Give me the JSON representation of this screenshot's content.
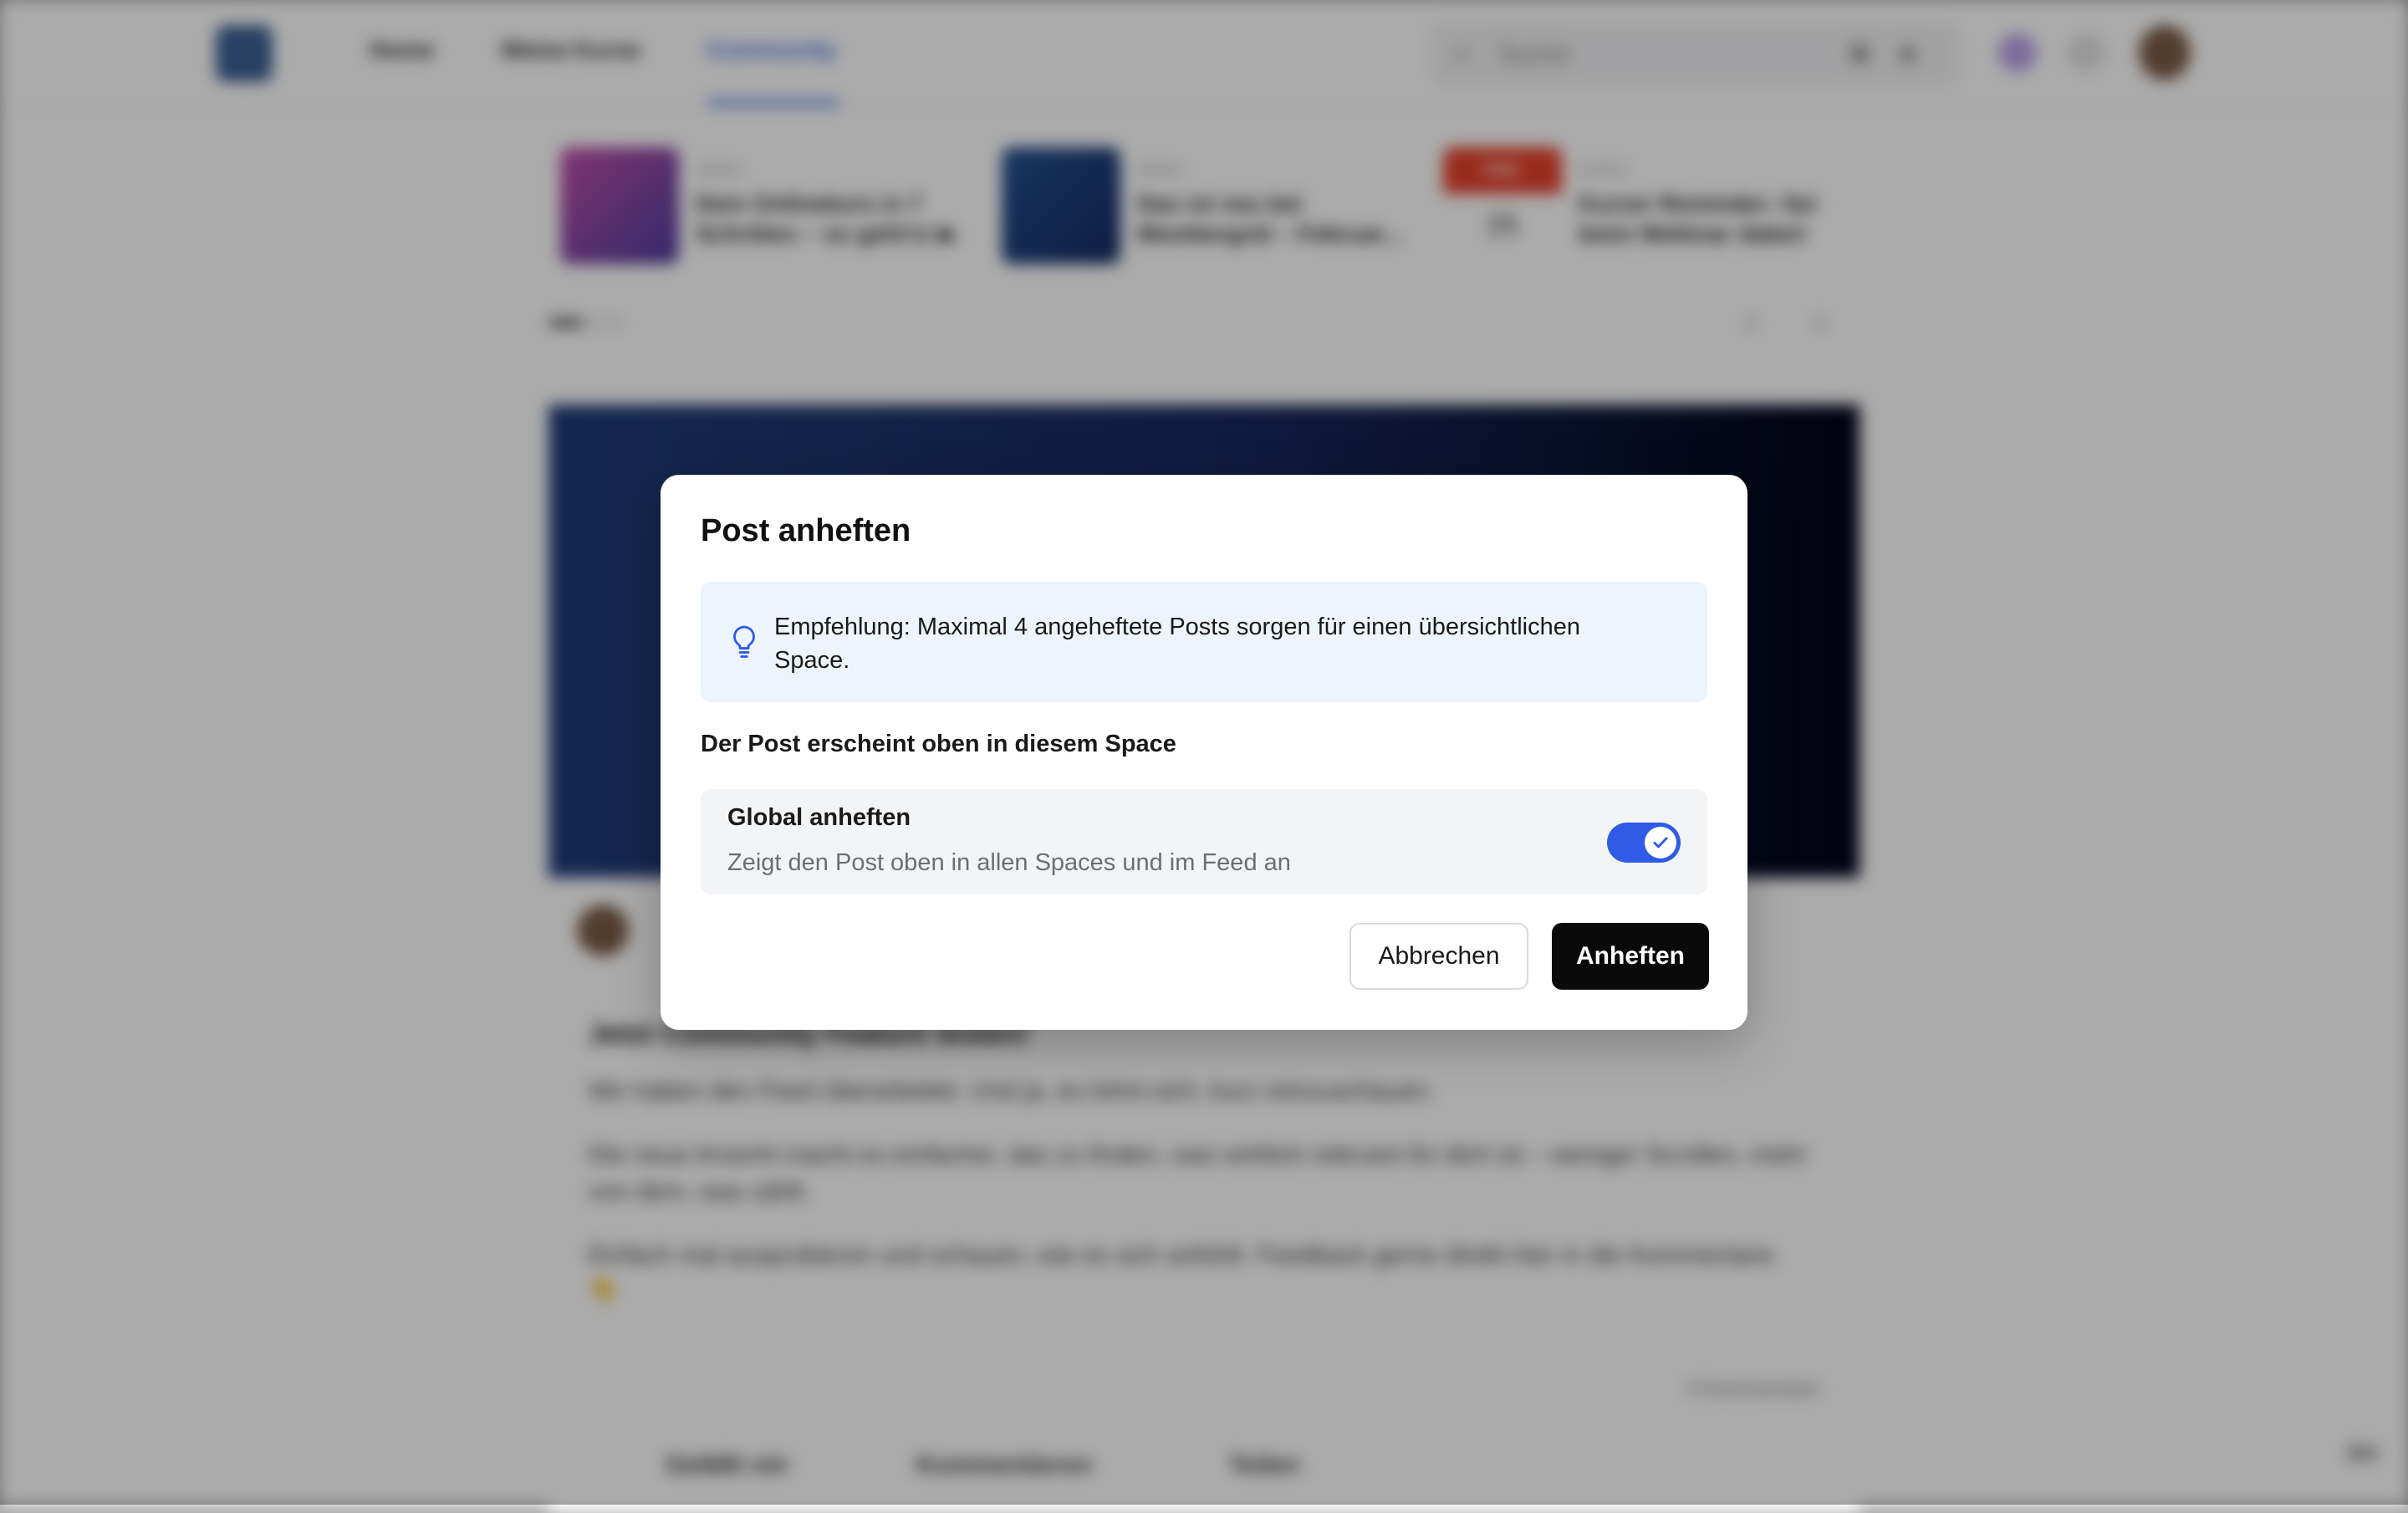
{
  "background": {
    "nav": {
      "items": [
        "Home",
        "Meine Kurse",
        "Community"
      ],
      "active": "Community"
    },
    "search": {
      "placeholder": "Suche",
      "shortcut_keys": [
        "⌘",
        "K"
      ]
    },
    "carousel": {
      "cards": [
        {
          "kicker": "NEWS",
          "title": "Dein Onlinekurs in 7 Schritten – so geht's! ▶",
          "thumb_color": "#8e4a9e"
        },
        {
          "kicker": "NEWS",
          "title": "Das ist neu bei Membergrid – Februar...",
          "thumb_color": "#1d3f7a"
        },
        {
          "kicker": "EVENT",
          "badge": "FEB.",
          "day": "25",
          "title": "Kurzer Reminder: Sei beim Webinar dabei!",
          "thumb_color": "#e5402a"
        }
      ]
    },
    "post": {
      "title": "Jetzt Community Feature testen!",
      "paragraphs": [
        "Wir haben den Feed überarbeitet. Und ja, es lohnt sich, kurz reinzuschauen.",
        "Die neue Ansicht macht es einfacher, das zu finden, was wirklich relevant für dich ist – weniger Scrollen, mehr von dem, was zählt.",
        "Einfach mal ausprobieren und schauen, wie es sich anfühlt. Feedback gerne direkt hier in die Kommentare. 👇"
      ],
      "comment_count": "0 Kommentare",
      "actions": [
        "Gefällt mir",
        "Kommentieren",
        "Teilen"
      ]
    },
    "help_label": "⌘K"
  },
  "dialog": {
    "title": "Post anheften",
    "tip_icon": "lightbulb-icon",
    "tip_text": "Empfehlung: Maximal 4 angeheftete Posts sorgen für einen übersichtlichen Space.",
    "section_label": "Der Post erscheint oben in diesem Space",
    "option": {
      "title": "Global anheften",
      "description": "Zeigt den Post oben in allen Spaces und im Feed an",
      "enabled": true
    },
    "buttons": {
      "cancel": "Abbrechen",
      "confirm": "Anheften"
    }
  },
  "colors": {
    "accent": "#2f5be6",
    "primary_button": "#0a0a0a",
    "tip_background": "#eef4fb",
    "option_background": "#f3f4f6"
  }
}
